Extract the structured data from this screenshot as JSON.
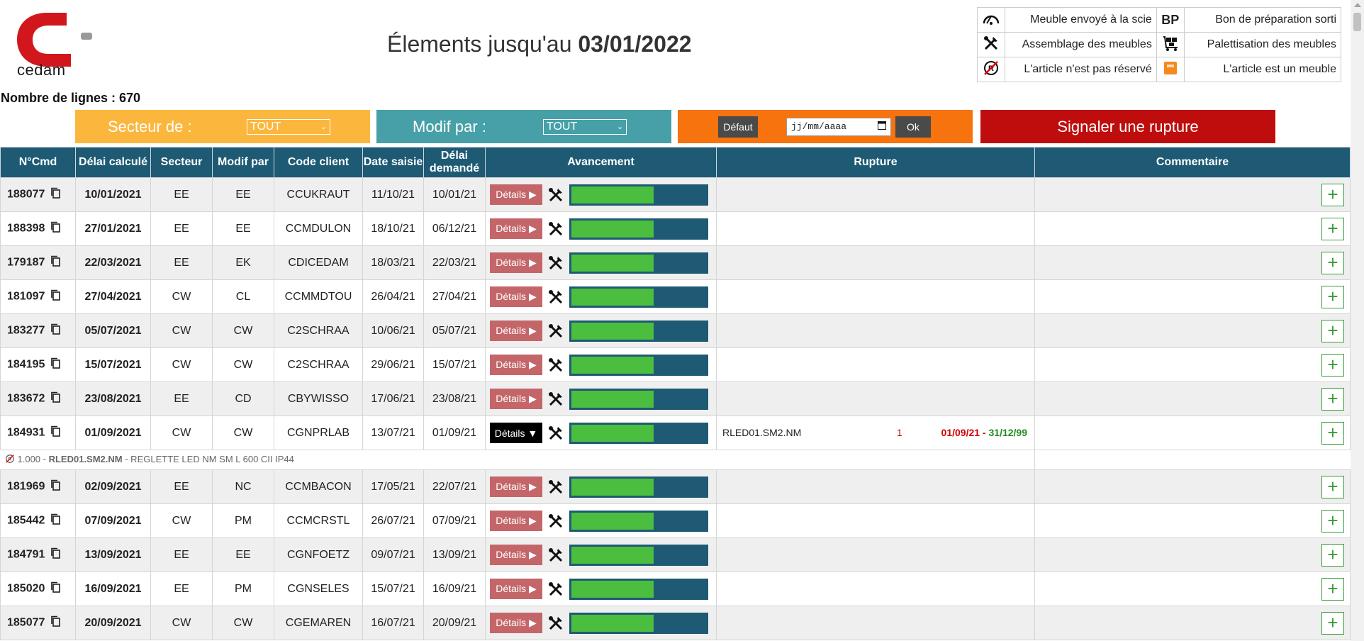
{
  "header": {
    "logo_text": "cedam",
    "title_prefix": "Élements jusqu'au",
    "title_date": "03/01/2022",
    "line_count": "Nombre de lignes : 670"
  },
  "legend": {
    "items": [
      {
        "icon": "saw-icon",
        "label": "Meuble envoyé à la scie"
      },
      {
        "icon": "bp-icon",
        "icon_text": "BP",
        "label": "Bon de préparation sorti"
      },
      {
        "icon": "tools-icon",
        "label": "Assemblage des meubles"
      },
      {
        "icon": "pallet-cart-icon",
        "label": "Palettisation des meubles"
      },
      {
        "icon": "not-reserved-icon",
        "label": "L'article n'est pas réservé"
      },
      {
        "icon": "furniture-box-icon",
        "label": "L'article est un meuble"
      }
    ]
  },
  "filters": {
    "secteur_label": "Secteur de :",
    "secteur_value": "TOUT",
    "modif_label": "Modif par :",
    "modif_value": "TOUT",
    "default_button": "Défaut",
    "date_placeholder": "jj/mm/aaaa",
    "ok_button": "Ok",
    "rupture_button": "Signaler une rupture"
  },
  "colors": {
    "header_bg": "#1e5a74",
    "secteur_bg": "#fbb73d",
    "modif_bg": "#47a0a8",
    "date_bg": "#f6730e",
    "rupture_bg": "#bf0d0d",
    "progress_fill": "#4bbd3f"
  },
  "table": {
    "headers": {
      "cmd": "N°Cmd",
      "delai_calc": "Délai calculé",
      "secteur": "Secteur",
      "modif": "Modif par",
      "client": "Code client",
      "date_saisie": "Date saisie",
      "delai_dem": "Délai demandé",
      "avancement": "Avancement",
      "rupture": "Rupture",
      "commentaire": "Commentaire"
    },
    "details_label": "Détails ▶",
    "details_open_label": "Détails ▼",
    "plus_label": "+",
    "rows": [
      {
        "cmd": "188077",
        "delai": "10/01/2021",
        "secteur": "EE",
        "modif": "EE",
        "client": "CCUKRAUT",
        "saisie": "11/10/21",
        "demande": "10/01/21",
        "progress": 0.62
      },
      {
        "cmd": "188398",
        "delai": "27/01/2021",
        "secteur": "EE",
        "modif": "EE",
        "client": "CCMDULON",
        "saisie": "18/10/21",
        "demande": "06/12/21",
        "progress": 0.62
      },
      {
        "cmd": "179187",
        "delai": "22/03/2021",
        "secteur": "EE",
        "modif": "EK",
        "client": "CDICEDAM",
        "saisie": "18/03/21",
        "demande": "22/03/21",
        "progress": 0.62
      },
      {
        "cmd": "181097",
        "delai": "27/04/2021",
        "secteur": "CW",
        "modif": "CL",
        "client": "CCMMDTOU",
        "saisie": "26/04/21",
        "demande": "27/04/21",
        "progress": 0.62
      },
      {
        "cmd": "183277",
        "delai": "05/07/2021",
        "secteur": "CW",
        "modif": "CW",
        "client": "C2SCHRAA",
        "saisie": "10/06/21",
        "demande": "05/07/21",
        "progress": 0.62
      },
      {
        "cmd": "184195",
        "delai": "15/07/2021",
        "secteur": "CW",
        "modif": "CW",
        "client": "C2SCHRAA",
        "saisie": "29/06/21",
        "demande": "15/07/21",
        "progress": 0.62
      },
      {
        "cmd": "183672",
        "delai": "23/08/2021",
        "secteur": "EE",
        "modif": "CD",
        "client": "CBYWISSO",
        "saisie": "17/06/21",
        "demande": "23/08/21",
        "progress": 0.62
      },
      {
        "cmd": "184931",
        "delai": "01/09/2021",
        "secteur": "CW",
        "modif": "CW",
        "client": "CGNPRLAB",
        "saisie": "13/07/21",
        "demande": "01/09/21",
        "progress": 0.62,
        "rupture": {
          "ref": "RLED01.SM2.NM",
          "qty": "1",
          "from": "01/09/21",
          "to": "31/12/99"
        }
      },
      {
        "cmd": "181969",
        "delai": "02/09/2021",
        "secteur": "EE",
        "modif": "NC",
        "client": "CCMBACON",
        "saisie": "17/05/21",
        "demande": "22/07/21",
        "progress": 0.62
      },
      {
        "cmd": "185442",
        "delai": "07/09/2021",
        "secteur": "CW",
        "modif": "PM",
        "client": "CCMCRSTL",
        "saisie": "26/07/21",
        "demande": "07/09/21",
        "progress": 0.62
      },
      {
        "cmd": "184791",
        "delai": "13/09/2021",
        "secteur": "EE",
        "modif": "EE",
        "client": "CGNFOETZ",
        "saisie": "09/07/21",
        "demande": "13/09/21",
        "progress": 0.62
      },
      {
        "cmd": "185020",
        "delai": "16/09/2021",
        "secteur": "EE",
        "modif": "PM",
        "client": "CGNSELES",
        "saisie": "15/07/21",
        "demande": "16/09/21",
        "progress": 0.62
      },
      {
        "cmd": "185077",
        "delai": "20/09/2021",
        "secteur": "CW",
        "modif": "CW",
        "client": "CGEMAREN",
        "saisie": "16/07/21",
        "demande": "20/09/21",
        "progress": 0.62
      }
    ],
    "subline": {
      "qty": "1.000 - ",
      "ref": "RLED01.SM2.NM",
      "desc": " - REGLETTE LED NM SM L 600 CII IP44"
    }
  }
}
